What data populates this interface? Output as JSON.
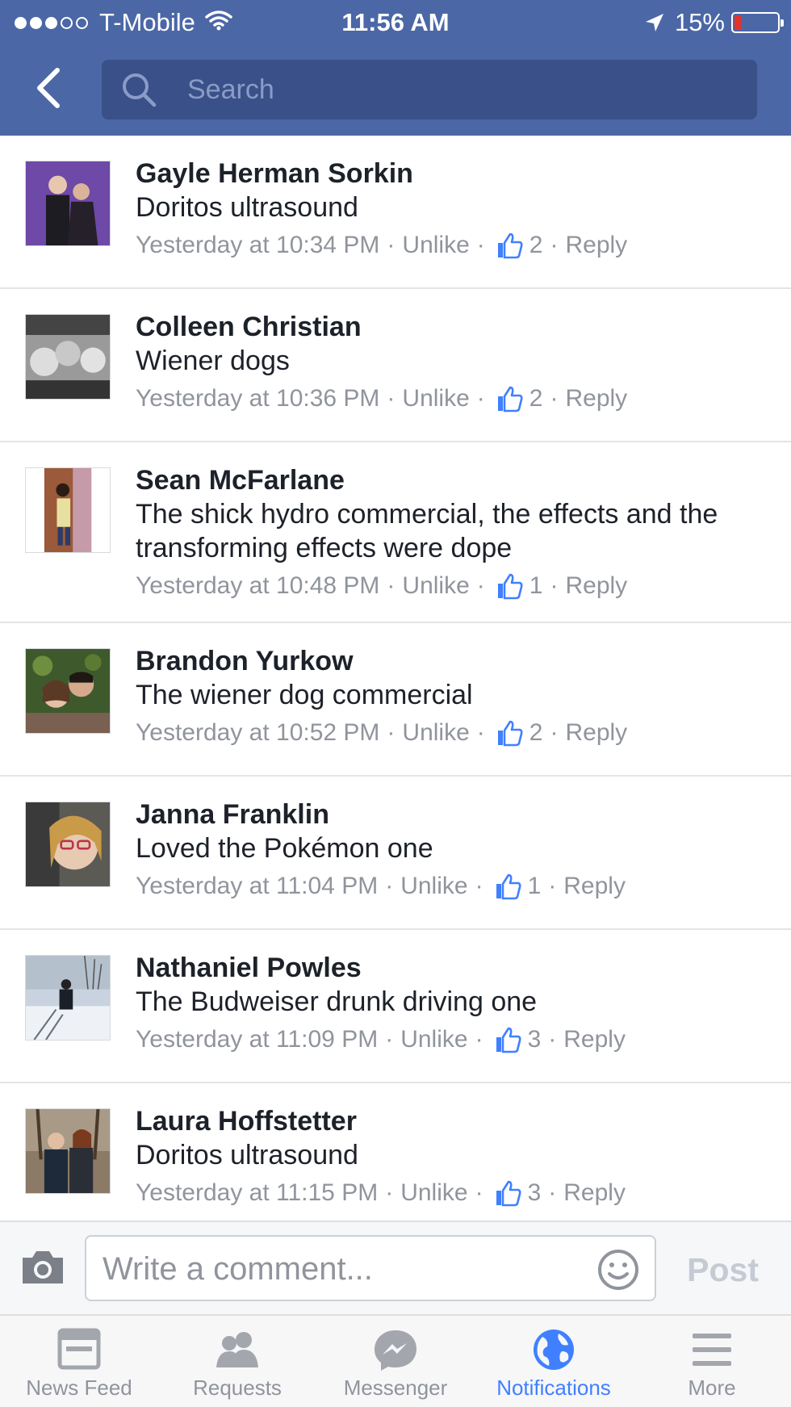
{
  "status_bar": {
    "carrier": "T-Mobile",
    "time": "11:56 AM",
    "battery": "15%",
    "battery_level": 0.15,
    "signal_bars": 3,
    "signal_total": 5
  },
  "header": {
    "search_placeholder": "Search"
  },
  "comments": [
    {
      "name": "Gayle Herman Sorkin",
      "text": "Doritos ultrasound",
      "time": "Yesterday at 10:34 PM",
      "unlike": "Unlike",
      "likes": "2",
      "reply": "Reply"
    },
    {
      "name": "Colleen Christian",
      "text": "Wiener dogs",
      "time": "Yesterday at 10:36 PM",
      "unlike": "Unlike",
      "likes": "2",
      "reply": "Reply"
    },
    {
      "name": "Sean McFarlane",
      "text": "The shick hydro commercial, the effects and the transforming effects were dope",
      "time": "Yesterday at 10:48 PM",
      "unlike": "Unlike",
      "likes": "1",
      "reply": "Reply"
    },
    {
      "name": "Brandon Yurkow",
      "text": "The wiener dog commercial",
      "time": "Yesterday at 10:52 PM",
      "unlike": "Unlike",
      "likes": "2",
      "reply": "Reply"
    },
    {
      "name": "Janna Franklin",
      "text": "Loved the Pokémon one",
      "time": "Yesterday at 11:04 PM",
      "unlike": "Unlike",
      "likes": "1",
      "reply": "Reply"
    },
    {
      "name": "Nathaniel Powles",
      "text": "The Budweiser drunk driving one",
      "time": "Yesterday at 11:09 PM",
      "unlike": "Unlike",
      "likes": "3",
      "reply": "Reply"
    },
    {
      "name": "Laura Hoffstetter",
      "text": "Doritos ultrasound",
      "time": "Yesterday at 11:15 PM",
      "unlike": "Unlike",
      "likes": "3",
      "reply": "Reply"
    }
  ],
  "composer": {
    "placeholder": "Write a comment...",
    "post_label": "Post"
  },
  "tabs": [
    {
      "label": "News Feed",
      "icon": "news-feed-icon",
      "active": false
    },
    {
      "label": "Requests",
      "icon": "friend-requests-icon",
      "active": false
    },
    {
      "label": "Messenger",
      "icon": "messenger-icon",
      "active": false
    },
    {
      "label": "Notifications",
      "icon": "globe-icon",
      "active": true
    },
    {
      "label": "More",
      "icon": "menu-icon",
      "active": false
    }
  ],
  "colors": {
    "header": "#4b67a6",
    "search_field": "#3a5089",
    "like_blue": "#4080ff",
    "meta_gray": "#90949c",
    "active_tab": "#4080ff"
  }
}
